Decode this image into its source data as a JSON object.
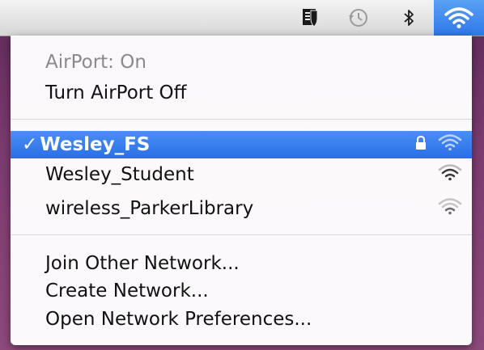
{
  "menubar": {
    "icons": [
      "document-shield-icon",
      "time-machine-icon",
      "bluetooth-icon",
      "wifi-icon"
    ]
  },
  "menu": {
    "status": "AirPort: On",
    "toggle": "Turn AirPort Off",
    "networks": [
      {
        "name": "Wesley_FS",
        "selected": true,
        "locked": true,
        "check": "✓"
      },
      {
        "name": "Wesley_Student",
        "selected": false,
        "locked": false
      },
      {
        "name": "wireless_ParkerLibrary",
        "selected": false,
        "locked": false
      }
    ],
    "actions": [
      "Join Other Network...",
      "Create Network...",
      "Open Network Preferences..."
    ]
  },
  "colors": {
    "highlight": "#2f78e8",
    "menubar": "#e4e4e4",
    "desktop": "#7a3a6e"
  }
}
